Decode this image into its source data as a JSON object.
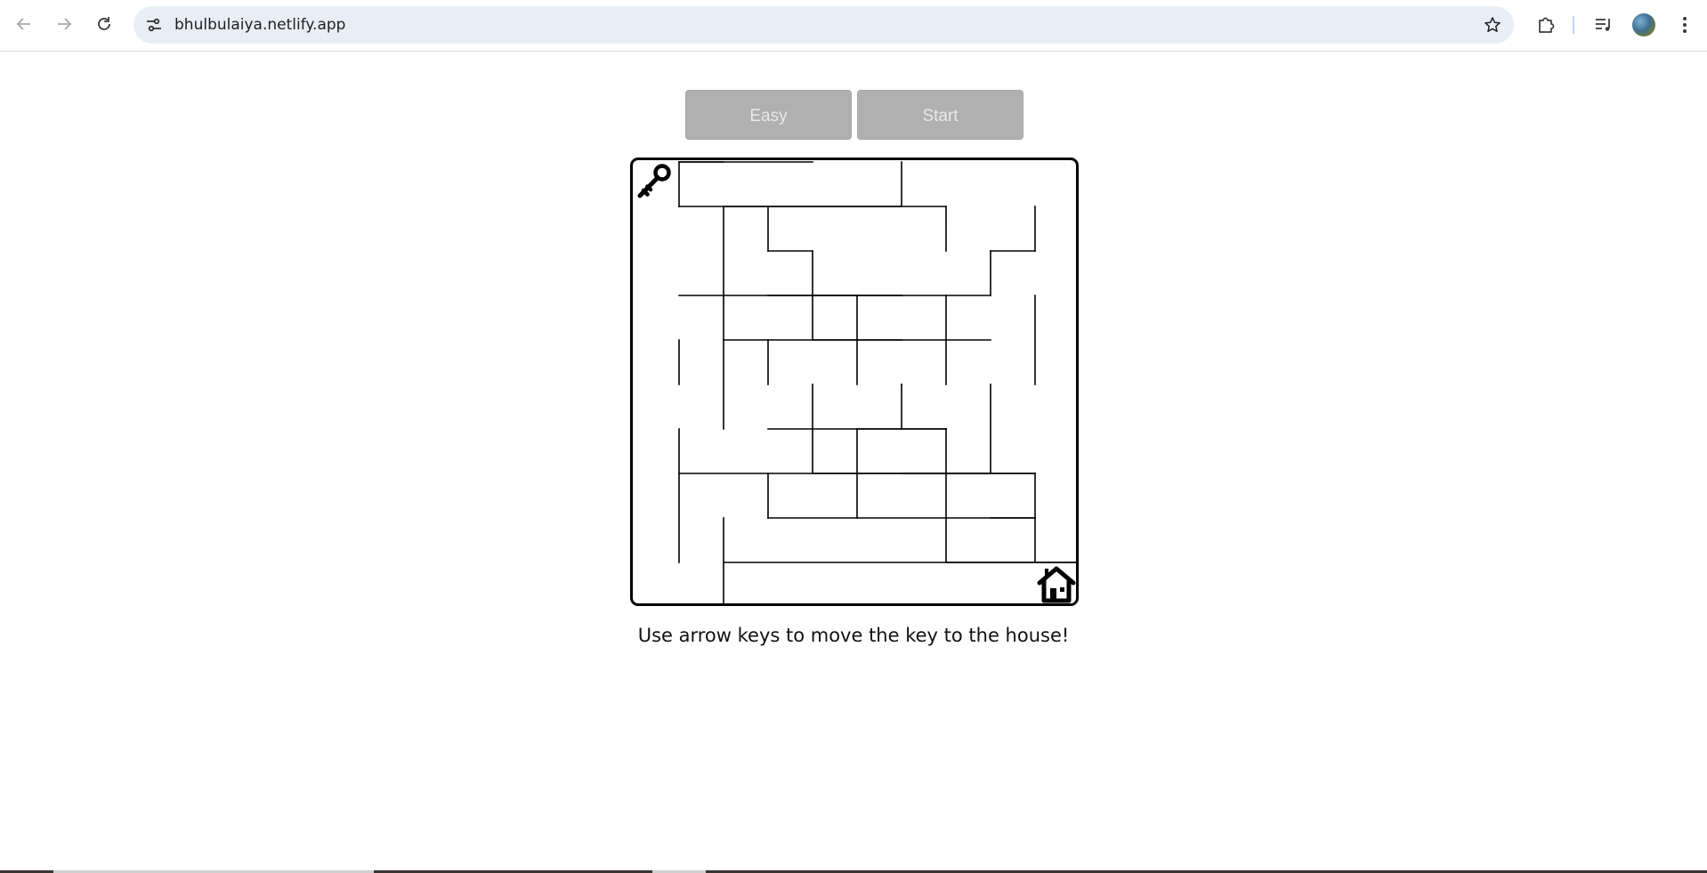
{
  "browser": {
    "url": "bhulbulaiya.netlify.app",
    "icons": {
      "back": "arrow-left-icon",
      "forward": "arrow-right-icon",
      "reload": "reload-icon",
      "site_info": "tune-icon",
      "bookmark": "star-icon",
      "extensions": "puzzle-icon",
      "media": "queue-music-icon",
      "profile": "avatar",
      "menu": "kebab-menu-icon"
    }
  },
  "game": {
    "difficulty_label": "Easy",
    "start_label": "Start",
    "instructions": "Use arrow keys to move the key to the house!",
    "grid": {
      "cols": 10,
      "rows": 10
    },
    "player": {
      "icon": "key-icon",
      "cell": [
        0,
        0
      ]
    },
    "goal": {
      "icon": "house-icon",
      "cell": [
        9,
        9
      ]
    },
    "walls": {
      "horizontal": [
        [
          1,
          1,
          2
        ],
        [
          3,
          1,
          6
        ],
        [
          7,
          1,
          8
        ],
        [
          0,
          2,
          1
        ],
        [
          4,
          2,
          8
        ],
        [
          9,
          2,
          10
        ],
        [
          1,
          3,
          2
        ],
        [
          3,
          3,
          4
        ],
        [
          6,
          3,
          7
        ],
        [
          8,
          3,
          9
        ],
        [
          0,
          4,
          1
        ],
        [
          2,
          4,
          3
        ],
        [
          4,
          4,
          6
        ],
        [
          7,
          4,
          9
        ],
        [
          3,
          5,
          4
        ],
        [
          6,
          5,
          7
        ],
        [
          1,
          6,
          2
        ],
        [
          3,
          6,
          4
        ],
        [
          5,
          6,
          6
        ],
        [
          7,
          6,
          9
        ],
        [
          1,
          7,
          3
        ],
        [
          6,
          7,
          7
        ],
        [
          9,
          7,
          10
        ],
        [
          3,
          8,
          6
        ],
        [
          8,
          8,
          9
        ],
        [
          2,
          9,
          8
        ]
      ],
      "vertical": [
        [
          1,
          0,
          1
        ],
        [
          6,
          0,
          1
        ],
        [
          2,
          1,
          6
        ],
        [
          3,
          1,
          2
        ],
        [
          7,
          1,
          2
        ],
        [
          9,
          1,
          2
        ],
        [
          4,
          2,
          4
        ],
        [
          8,
          2,
          3
        ],
        [
          5,
          3,
          5
        ],
        [
          7,
          3,
          5
        ],
        [
          9,
          3,
          5
        ],
        [
          1,
          4,
          5
        ],
        [
          3,
          4,
          5
        ],
        [
          4,
          5,
          7
        ],
        [
          6,
          5,
          6
        ],
        [
          8,
          5,
          7
        ],
        [
          1,
          6,
          9
        ],
        [
          5,
          6,
          8
        ],
        [
          7,
          6,
          9
        ],
        [
          3,
          7,
          8
        ],
        [
          9,
          7,
          9
        ],
        [
          2,
          8,
          10
        ]
      ]
    },
    "colors": {
      "button_bg": "#b0b0b0",
      "button_text": "#e9e9e9",
      "wall": "#000000"
    }
  }
}
